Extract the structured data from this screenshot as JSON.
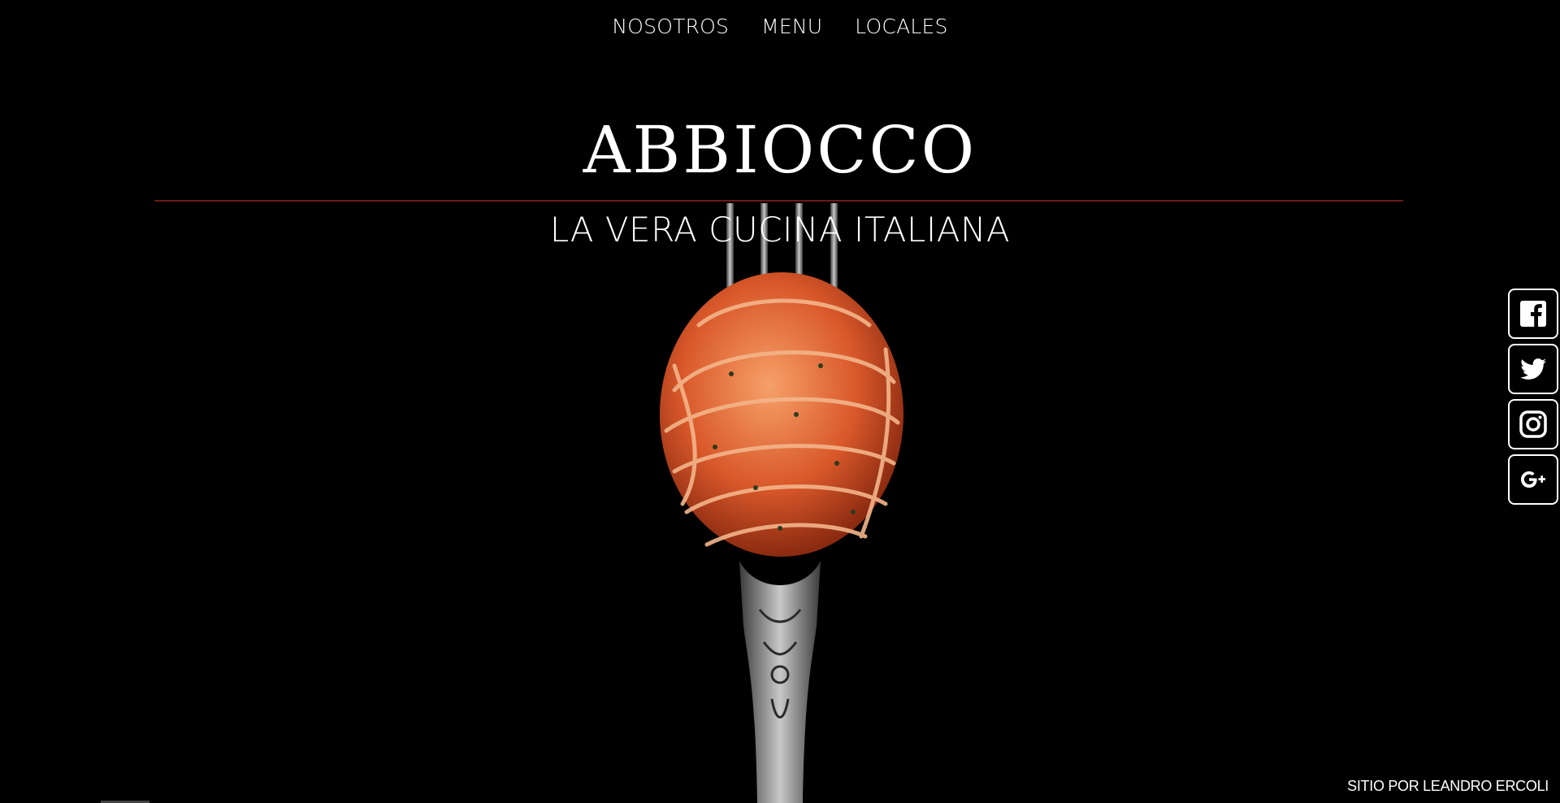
{
  "nav": {
    "items": [
      {
        "label": "NOSOTROS"
      },
      {
        "label": "MENU"
      },
      {
        "label": "LOCALES"
      }
    ]
  },
  "hero": {
    "title": "ABBIOCCO",
    "subtitle": "LA VERA CUCINA ITALIANA",
    "image_icon": "fork-with-spaghetti-icon"
  },
  "social": [
    {
      "icon": "facebook-icon"
    },
    {
      "icon": "twitter-icon"
    },
    {
      "icon": "instagram-icon"
    },
    {
      "icon": "google-plus-icon"
    }
  ],
  "footer": {
    "credit": "SITIO POR LEANDRO ERCOLI"
  },
  "colors": {
    "background": "#000000",
    "text": "#ffffff",
    "divider": "#6b1a1a",
    "pasta": "#e0672f"
  }
}
